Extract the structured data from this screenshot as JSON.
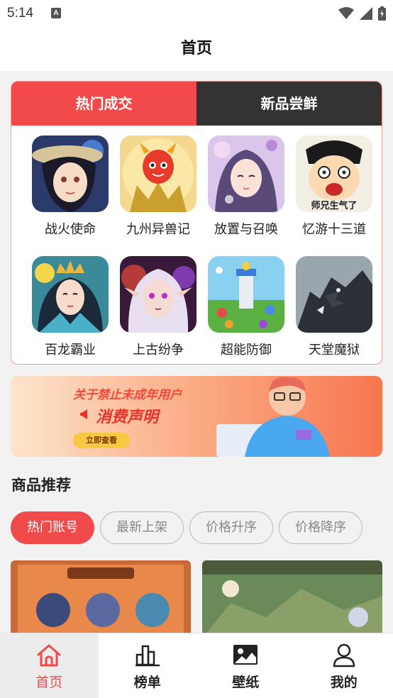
{
  "status_bar": {
    "time": "5:14",
    "notification_letter": "A"
  },
  "header": {
    "title": "首页"
  },
  "hot_section": {
    "tabs": [
      {
        "label": "热门成交",
        "active": true
      },
      {
        "label": "新品尝鲜",
        "active": false
      }
    ],
    "games": [
      {
        "name": "战火使命",
        "icon": "anime-girl-hat-icon"
      },
      {
        "name": "九州异兽记",
        "icon": "red-dragon-egg-icon"
      },
      {
        "name": "放置与召唤",
        "icon": "purple-hair-fairy-icon"
      },
      {
        "name": "忆游十三道",
        "icon": "cartoon-shouting-man-icon"
      },
      {
        "name": "百龙霸业",
        "icon": "crowned-queen-icon"
      },
      {
        "name": "上古纷争",
        "icon": "white-hair-elf-icon"
      },
      {
        "name": "超能防御",
        "icon": "tower-defense-icon"
      },
      {
        "name": "天堂魔狱",
        "icon": "dark-wolf-dragon-icon"
      }
    ]
  },
  "banner": {
    "line1": "关于禁止未成年用户",
    "line2": "消费声明",
    "button": "立即查看"
  },
  "recommend": {
    "title": "商品推荐",
    "filters": [
      {
        "label": "热门账号",
        "active": true
      },
      {
        "label": "最新上架",
        "active": false
      },
      {
        "label": "价格升序",
        "active": false
      },
      {
        "label": "价格降序",
        "active": false
      }
    ]
  },
  "bottom_nav": [
    {
      "label": "首页",
      "icon": "home-icon",
      "active": true
    },
    {
      "label": "榜单",
      "icon": "ranking-bars-icon",
      "active": false
    },
    {
      "label": "壁纸",
      "icon": "image-icon",
      "active": false
    },
    {
      "label": "我的",
      "icon": "user-icon",
      "active": false
    }
  ],
  "colors": {
    "accent": "#f24a4a",
    "dark_tab": "#333333",
    "background": "#f2f2f2"
  }
}
